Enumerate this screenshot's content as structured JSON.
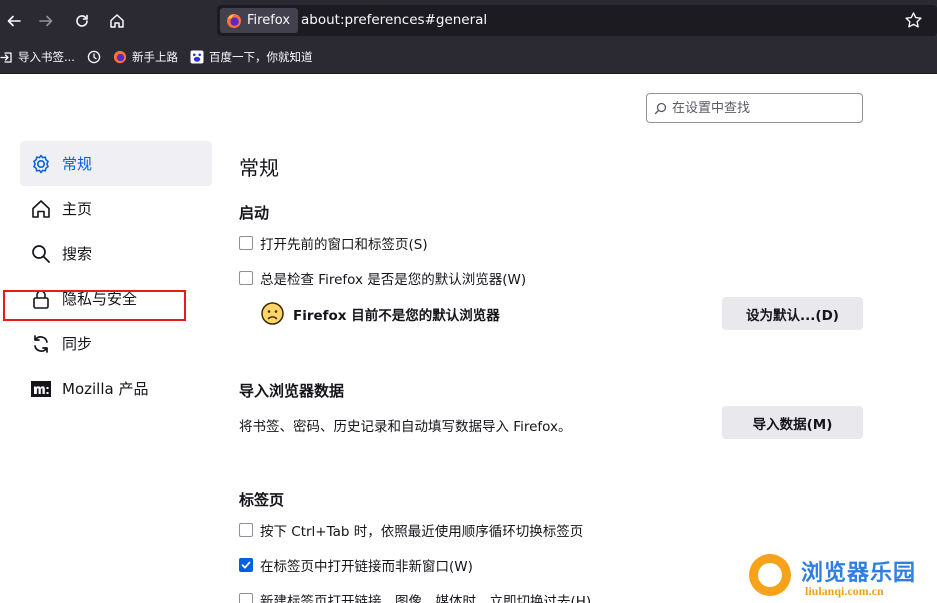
{
  "browser": {
    "identity_label": "Firefox",
    "url": "about:preferences#general"
  },
  "bookmarks": [
    {
      "icon": "import-icon",
      "label": "导入书签..."
    },
    {
      "icon": "clock-icon",
      "label": ""
    },
    {
      "icon": "firefox-icon",
      "label": "新手上路"
    },
    {
      "icon": "baidu-icon",
      "label": "百度一下，你就知道"
    }
  ],
  "search": {
    "placeholder": "在设置中查找"
  },
  "sidebar": {
    "items": [
      {
        "label": "常规",
        "icon": "gear-icon",
        "selected": true
      },
      {
        "label": "主页",
        "icon": "home-icon"
      },
      {
        "label": "搜索",
        "icon": "search-icon"
      },
      {
        "label": "隐私与安全",
        "icon": "lock-icon"
      },
      {
        "label": "同步",
        "icon": "sync-icon"
      },
      {
        "label": "Mozilla 产品",
        "icon": "mozilla-icon"
      }
    ]
  },
  "main": {
    "title": "常规",
    "startup": {
      "heading": "启动",
      "open_previous": "打开先前的窗口和标签页(S)",
      "check_default": "总是检查 Firefox 是否是您的默认浏览器(W)",
      "status_text": "Firefox 目前不是您的默认浏览器",
      "set_default_button": "设为默认...(D)"
    },
    "import": {
      "heading": "导入浏览器数据",
      "description": "将书签、密码、历史记录和自动填写数据导入 Firefox。",
      "button": "导入数据(M)"
    },
    "tabs": {
      "heading": "标签页",
      "ctrl_tab": "按下 Ctrl+Tab 时，依照最近使用顺序循环切换标签页",
      "open_links": "在标签页中打开链接而非新窗口(W)",
      "switch_to_new": "新建标签页打开链接、图像、媒体时，立即切换过去(H)"
    },
    "checkbox_states": {
      "open_previous": false,
      "check_default": false,
      "ctrl_tab": false,
      "open_links": true,
      "switch_to_new": false
    }
  },
  "watermark": {
    "title": "浏览器乐园",
    "url": "liulanqi.com.cn"
  },
  "colors": {
    "toolbar_bg": "#2b2a33",
    "urlbar_bg": "#1c1b22",
    "accent": "#0061e0",
    "highlight_red": "#e81a1a",
    "button_bg": "#e9e9ed"
  }
}
